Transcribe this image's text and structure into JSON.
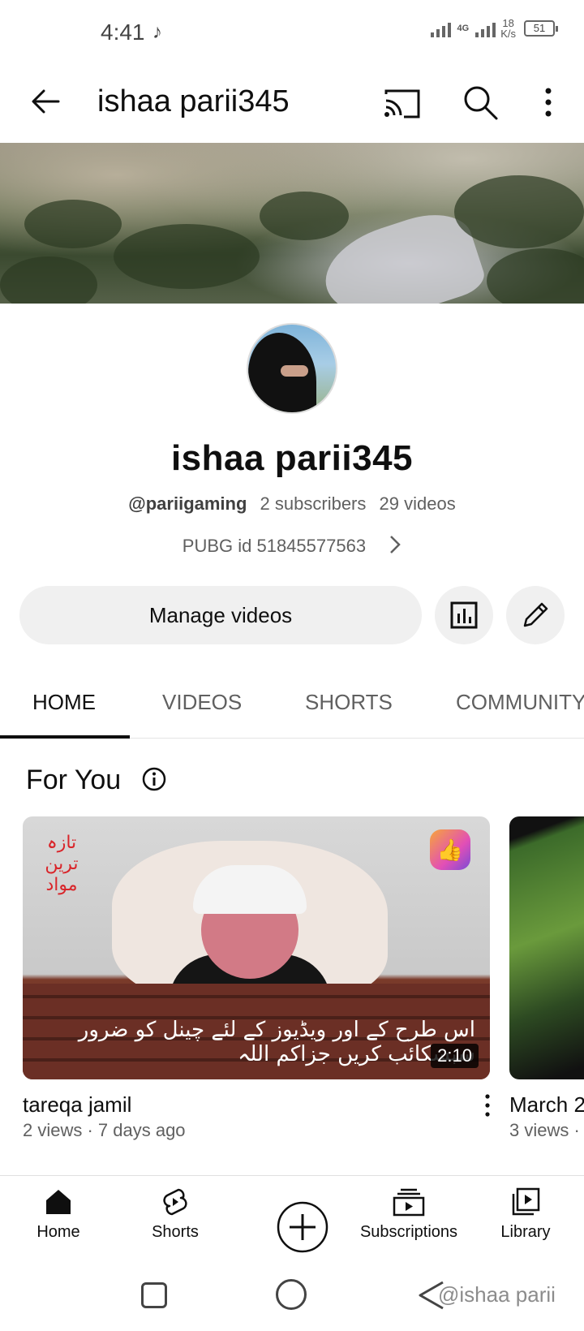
{
  "status_bar": {
    "time": "4:41",
    "network": "4G",
    "speed_value": "18",
    "speed_unit": "K/s",
    "battery": "51"
  },
  "app_bar": {
    "title": "ishaa parii345"
  },
  "channel": {
    "name": "ishaa parii345",
    "handle": "@pariigaming",
    "subscribers": "2 subscribers",
    "videos": "29 videos",
    "description": "PUBG id 51845577563"
  },
  "actions": {
    "manage_label": "Manage videos"
  },
  "tabs": [
    {
      "label": "HOME",
      "active": true
    },
    {
      "label": "VIDEOS",
      "active": false
    },
    {
      "label": "SHORTS",
      "active": false
    },
    {
      "label": "COMMUNITY",
      "active": false
    }
  ],
  "section": {
    "title": "For You"
  },
  "videos": [
    {
      "title": "tareqa jamil",
      "meta": "2 views · 7 days ago",
      "duration": "2:10",
      "overlay_text": "اس طرح کے اور ویڈیوز کے لئے چینل کو ضرور سبسکائب کریں جزاکم اللہ",
      "corner_text": "تازہ ترین مواد"
    },
    {
      "title": "March 2",
      "meta": "3 views ·"
    }
  ],
  "bottom_nav": [
    {
      "label": "Home",
      "icon": "home-icon"
    },
    {
      "label": "Shorts",
      "icon": "shorts-icon"
    },
    {
      "label": "",
      "icon": "create-icon"
    },
    {
      "label": "Subscriptions",
      "icon": "subscriptions-icon"
    },
    {
      "label": "Library",
      "icon": "library-icon"
    }
  ],
  "watermark": "@ishaa parii"
}
